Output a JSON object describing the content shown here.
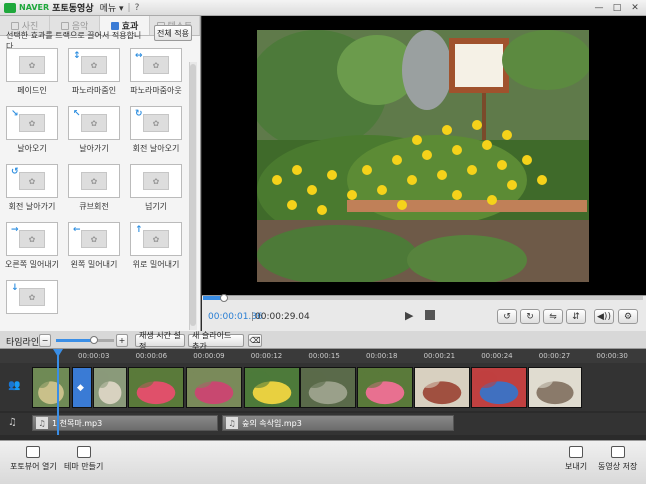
{
  "titlebar": {
    "brand": "NAVER",
    "app_name": "포토동영상",
    "menu_label": "메뉴 ▾",
    "separator": "|",
    "help": "?",
    "minimize": "—",
    "maximize": "□",
    "close": "✕"
  },
  "tabs": [
    {
      "label": "사진",
      "active": false
    },
    {
      "label": "음악",
      "active": false
    },
    {
      "label": "효과",
      "active": true
    },
    {
      "label": "텍스트",
      "active": false
    }
  ],
  "effects_panel": {
    "instruction": "선택한 효과를 트랙으로 끌어서 적용합니다.",
    "apply_all_label": "전체 적용",
    "effects": [
      {
        "label": "페이드인",
        "arrow": ""
      },
      {
        "label": "파노라마줌인",
        "arrow": "↕"
      },
      {
        "label": "파노라마줌아웃",
        "arrow": "↔"
      },
      {
        "label": "날아오기",
        "arrow": "↘"
      },
      {
        "label": "날아가기",
        "arrow": "↖"
      },
      {
        "label": "회전 날아오기",
        "arrow": "↻"
      },
      {
        "label": "회전 날아가기",
        "arrow": "↺"
      },
      {
        "label": "큐브회전",
        "arrow": ""
      },
      {
        "label": "넘기기",
        "arrow": ""
      },
      {
        "label": "오른쪽 밀어내기",
        "arrow": "→"
      },
      {
        "label": "왼쪽 밀어내기",
        "arrow": "←"
      },
      {
        "label": "위로 밀어내기",
        "arrow": "↑"
      },
      {
        "label": "",
        "arrow": "↓"
      }
    ]
  },
  "player": {
    "current_time": "00:00:01.36",
    "time_separator": "|",
    "total_time": "00:00:29.04",
    "progress_fraction": 0.047,
    "buttons": {
      "rotate_left": "↺",
      "rotate_right": "↻",
      "flip_h": "⇋",
      "flip_v": "⇵",
      "volume": "◀))",
      "settings": "⚙"
    }
  },
  "timeline": {
    "label": "타임라인",
    "zoom_out": "−",
    "zoom_in": "+",
    "zoom_fraction": 0.65,
    "play_time_button": "재생 시간 설정",
    "add_slide_button": "새 슬라이드 추가",
    "delete_icon": "🗑",
    "ruler_ticks": [
      "00:00:03",
      "00:00:06",
      "00:00:09",
      "00:00:12",
      "00:00:15",
      "00:00:18",
      "00:00:21",
      "00:00:24",
      "00:00:27",
      "00:00:30"
    ],
    "audio_clips": [
      {
        "title": "1.천목마.mp3"
      },
      {
        "title": "숲의 속삭임.mp3"
      }
    ]
  },
  "bottombar": {
    "open_photo_viewer": "포토뷰어 열기",
    "make_theme": "테마 만들기",
    "export": "보내기",
    "save_video": "동영상 저장"
  },
  "colors": {
    "accent": "#3a8ee6",
    "brand": "#1fa83c"
  }
}
